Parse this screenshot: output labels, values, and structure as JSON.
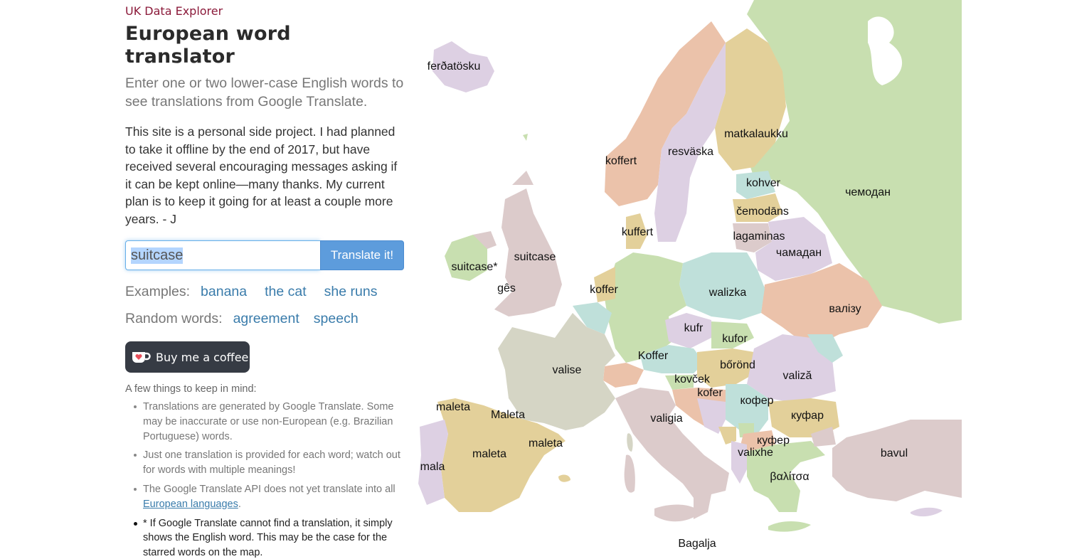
{
  "header": {
    "brand": "UK Data Explorer",
    "title": "European word translator",
    "lead": "Enter one or two lower-case English words to see translations from Google Translate."
  },
  "about": "This site is a personal side project. I had planned to take it offline by the end of 2017, but have received several encouraging messages asking if it can be kept online—many thanks. My current plan is to keep it going for at least a couple more years. - J",
  "search": {
    "value": "suitcase",
    "button_label": "Translate it!"
  },
  "examples": {
    "label": "Examples:",
    "items": [
      "banana",
      "the cat",
      "she runs"
    ]
  },
  "random": {
    "label": "Random words:",
    "items": [
      "agreement",
      "speech"
    ]
  },
  "coffee": {
    "label": "Buy me a coffee",
    "icon": "coffee-cup-heart-icon"
  },
  "notes": {
    "heading": "A few things to keep in mind:",
    "items": [
      "Translations are generated by Google Translate. Some may be inaccurate or use non-European (e.g. Brazilian Portuguese) words.",
      "Just one translation is provided for each word; watch out for words with multiple meanings!",
      "The Google Translate API does not yet translate into all",
      "* If Google Translate cannot find a translation, it simply shows the English word. This may be the case for the starred words on the map."
    ],
    "link_text": "European languages",
    "link_suffix": "."
  },
  "colors": {
    "brand": "#8b1a3a",
    "link": "#3a7cab",
    "button": "#5d9cdc",
    "coffee_bg": "#363b44",
    "map_pink": "#dccbcb",
    "map_lilac": "#ddd0e3",
    "map_green": "#c8dfb0",
    "map_salmon": "#ebc2aa",
    "map_sand": "#e3d09a",
    "map_teal": "#bfe0da",
    "map_grey": "#d5d5c5"
  },
  "map": {
    "labels": [
      {
        "country": "iceland",
        "word": "ferðatösku"
      },
      {
        "country": "norway",
        "word": "koffert"
      },
      {
        "country": "sweden",
        "word": "resväska"
      },
      {
        "country": "finland",
        "word": "matkalaukku"
      },
      {
        "country": "estonia",
        "word": "kohver"
      },
      {
        "country": "russia",
        "word": "чемодан"
      },
      {
        "country": "latvia",
        "word": "čemodāns"
      },
      {
        "country": "lithuania",
        "word": "lagaminas"
      },
      {
        "country": "belarus",
        "word": "чамадан"
      },
      {
        "country": "denmark",
        "word": "kuffert"
      },
      {
        "country": "uk",
        "word": "suitcase"
      },
      {
        "country": "ireland",
        "word": "suitcase*"
      },
      {
        "country": "wales",
        "word": "gês"
      },
      {
        "country": "netherlands",
        "word": "koffer"
      },
      {
        "country": "poland",
        "word": "walizka"
      },
      {
        "country": "ukraine",
        "word": "валізу"
      },
      {
        "country": "czechia",
        "word": "kufr"
      },
      {
        "country": "slovakia",
        "word": "kufor"
      },
      {
        "country": "germany",
        "word": "Koffer"
      },
      {
        "country": "france",
        "word": "valise"
      },
      {
        "country": "hungary",
        "word": "bőrönd"
      },
      {
        "country": "romania",
        "word": "valiză"
      },
      {
        "country": "slovenia",
        "word": "kovček"
      },
      {
        "country": "croatia",
        "word": "kofer"
      },
      {
        "country": "serbia",
        "word": "кофер"
      },
      {
        "country": "bulgaria",
        "word": "куфар"
      },
      {
        "country": "galicia",
        "word": "maleta"
      },
      {
        "country": "basque",
        "word": "Maleta"
      },
      {
        "country": "italy",
        "word": "valigia"
      },
      {
        "country": "catalonia",
        "word": "maleta"
      },
      {
        "country": "spain",
        "word": "maleta"
      },
      {
        "country": "portugal",
        "word": "mala"
      },
      {
        "country": "north-macedonia",
        "word": "куфер"
      },
      {
        "country": "albania",
        "word": "valixhe"
      },
      {
        "country": "turkey",
        "word": "bavul"
      },
      {
        "country": "greece",
        "word": "βαλίτσα"
      },
      {
        "country": "malta",
        "word": "Bagalja"
      }
    ]
  }
}
